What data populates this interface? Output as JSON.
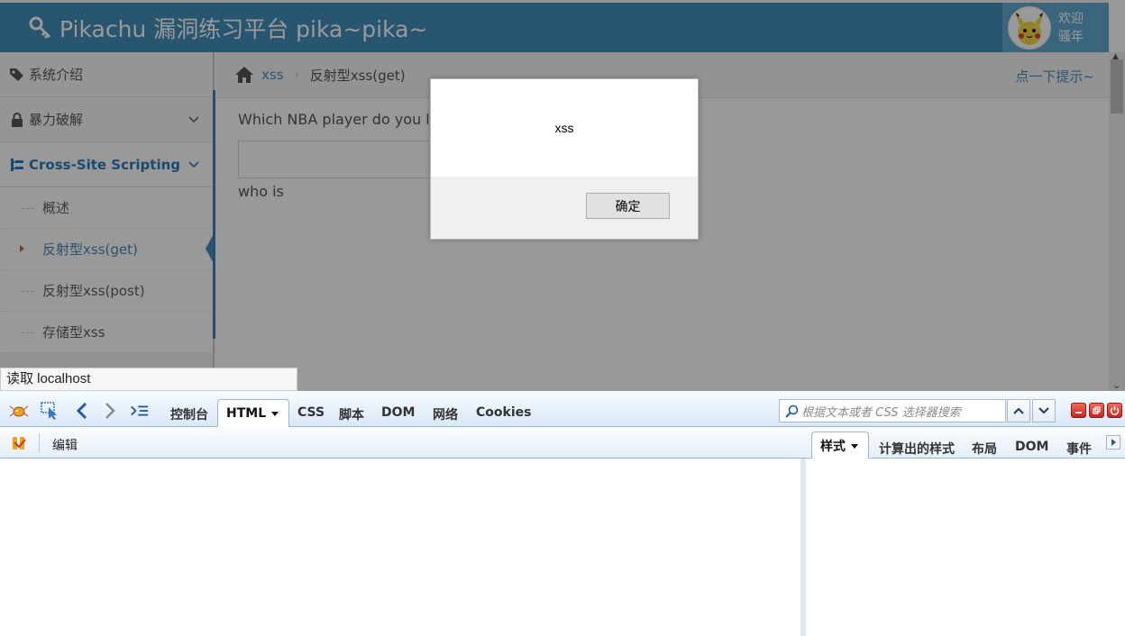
{
  "header": {
    "brand": "Pikachu 漏洞练习平台 pika~pika~",
    "welcome_line1": "欢迎",
    "welcome_line2": "骚年"
  },
  "sidebar": {
    "items": [
      {
        "label": "系统介绍"
      },
      {
        "label": "暴力破解"
      },
      {
        "label": "Cross-Site Scripting"
      }
    ],
    "subitems": [
      {
        "label": "概述"
      },
      {
        "label": "反射型xss(get)"
      },
      {
        "label": "反射型xss(post)"
      },
      {
        "label": "存储型xss"
      }
    ]
  },
  "breadcrumb": {
    "section": "xss",
    "separator": "›",
    "current": "反射型xss(get)",
    "hint": "点一下提示~"
  },
  "content": {
    "question": "Which NBA player do you lik",
    "input_value": "",
    "result": "who is"
  },
  "status_bar": {
    "text": "读取 localhost"
  },
  "alert": {
    "message": "xss",
    "ok_label": "确定"
  },
  "firebug": {
    "tabs": [
      "控制台",
      "HTML",
      "CSS",
      "脚本",
      "DOM",
      "网络",
      "Cookies"
    ],
    "active_tab": "HTML",
    "search_placeholder": "根据文本或者 CSS 选择器搜索",
    "edit_label": "编辑",
    "side_tabs": [
      "样式",
      "计算出的样式",
      "布局",
      "DOM",
      "事件"
    ],
    "active_side_tab": "样式"
  },
  "colors": {
    "navbar": "#438eb9",
    "accent": "#4c8fbd",
    "firebug_bar": "#dae8f7"
  }
}
